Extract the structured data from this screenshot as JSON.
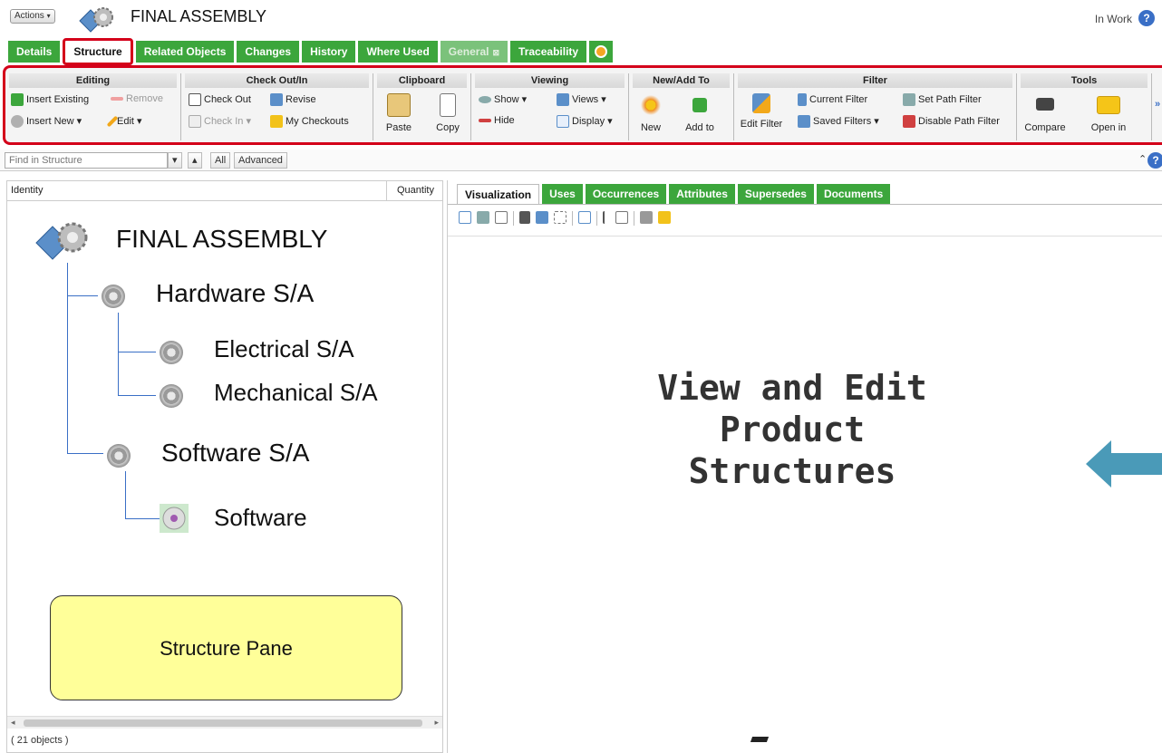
{
  "header": {
    "actions_label": "Actions",
    "title": "FINAL ASSEMBLY",
    "status": "In Work",
    "help_icon": "question-icon"
  },
  "tabs": [
    {
      "label": "Details"
    },
    {
      "label": "Structure"
    },
    {
      "label": "Related Objects"
    },
    {
      "label": "Changes"
    },
    {
      "label": "History"
    },
    {
      "label": "Where Used"
    },
    {
      "label": "General"
    },
    {
      "label": "Traceability"
    }
  ],
  "ribbon": {
    "editing": {
      "title": "Editing",
      "insert_existing": "Insert Existing",
      "remove": "Remove",
      "insert_new": "Insert New",
      "edit": "Edit"
    },
    "checkout": {
      "title": "Check Out/In",
      "check_out": "Check Out",
      "revise": "Revise",
      "check_in": "Check In",
      "my_checkouts": "My Checkouts"
    },
    "clipboard": {
      "title": "Clipboard",
      "paste": "Paste",
      "copy": "Copy"
    },
    "viewing": {
      "title": "Viewing",
      "show": "Show",
      "views": "Views",
      "hide": "Hide",
      "display": "Display"
    },
    "newadd": {
      "title": "New/Add To",
      "new": "New",
      "add_to": "Add to"
    },
    "filter": {
      "title": "Filter",
      "edit_filter": "Edit Filter",
      "current_filter": "Current Filter",
      "set_path_filter": "Set Path Filter",
      "saved_filters": "Saved Filters",
      "disable_path_filter": "Disable Path Filter"
    },
    "tools": {
      "title": "Tools",
      "compare": "Compare",
      "open_in": "Open in"
    },
    "more": "»"
  },
  "findbar": {
    "placeholder": "Find in Structure",
    "all_label": "All",
    "advanced_label": "Advanced"
  },
  "structure": {
    "col_identity": "Identity",
    "col_quantity": "Quantity",
    "nodes": [
      {
        "label": "FINAL ASSEMBLY"
      },
      {
        "label": "Hardware S/A"
      },
      {
        "label": "Electrical S/A"
      },
      {
        "label": "Mechanical S/A"
      },
      {
        "label": "Software S/A"
      },
      {
        "label": "Software"
      }
    ],
    "callout": "Structure Pane",
    "object_count": "( 21 objects )"
  },
  "visual": {
    "tabs": [
      {
        "label": "Visualization"
      },
      {
        "label": "Uses"
      },
      {
        "label": "Occurrences"
      },
      {
        "label": "Attributes"
      },
      {
        "label": "Supersedes"
      },
      {
        "label": "Documents"
      }
    ],
    "headline_line1": "View and Edit",
    "headline_line2": "Product",
    "headline_line3": "Structures",
    "arrow_color": "#4a9ab8"
  }
}
